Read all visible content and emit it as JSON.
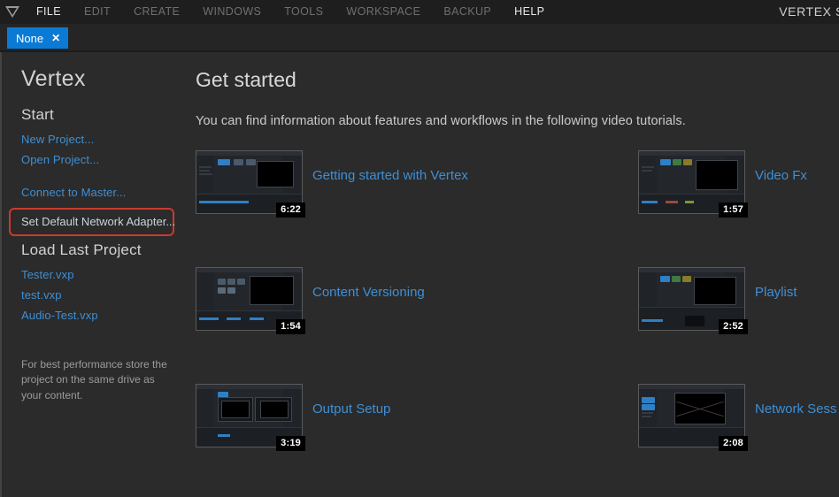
{
  "menubar": {
    "logo_icon": "triangle-logo-icon",
    "items": [
      {
        "label": "FILE",
        "active": true
      },
      {
        "label": "EDIT",
        "active": false
      },
      {
        "label": "CREATE",
        "active": false
      },
      {
        "label": "WINDOWS",
        "active": false
      },
      {
        "label": "TOOLS",
        "active": false
      },
      {
        "label": "WORKSPACE",
        "active": false
      },
      {
        "label": "BACKUP",
        "active": false
      },
      {
        "label": "HELP",
        "active": true
      }
    ],
    "app_title": "VERTEX S"
  },
  "tabstrip": {
    "tab_label": "None",
    "close_icon": "✕",
    "accent_color": "#0b7ad4"
  },
  "sidebar": {
    "brand": "Vertex",
    "start_heading": "Start",
    "start_links": [
      "New Project...",
      "Open Project..."
    ],
    "connect_link": "Connect to Master...",
    "highlighted_item": {
      "label": "Set Default Network Adapter...",
      "highlight_color": "#c93b2e"
    },
    "load_heading": "Load Last Project",
    "recent_projects": [
      "Tester.vxp",
      "test.vxp",
      "Audio-Test.vxp"
    ],
    "hint": "For best performance store the project on the same drive as your content."
  },
  "main": {
    "title": "Get started",
    "subtitle": "You can find information about features and workflows in the following video tutorials.",
    "videos": [
      {
        "title": "Getting started with Vertex",
        "duration": "6:22",
        "style": "warm"
      },
      {
        "title": "Video Fx",
        "duration": "1:57",
        "style": "blue"
      },
      {
        "title": "Content Versioning",
        "duration": "1:54",
        "style": "swirl"
      },
      {
        "title": "Playlist",
        "duration": "2:52",
        "style": "green"
      },
      {
        "title": "Output Setup",
        "duration": "3:19",
        "style": "grey"
      },
      {
        "title": "Network Sess",
        "duration": "2:08",
        "style": "black"
      }
    ]
  }
}
